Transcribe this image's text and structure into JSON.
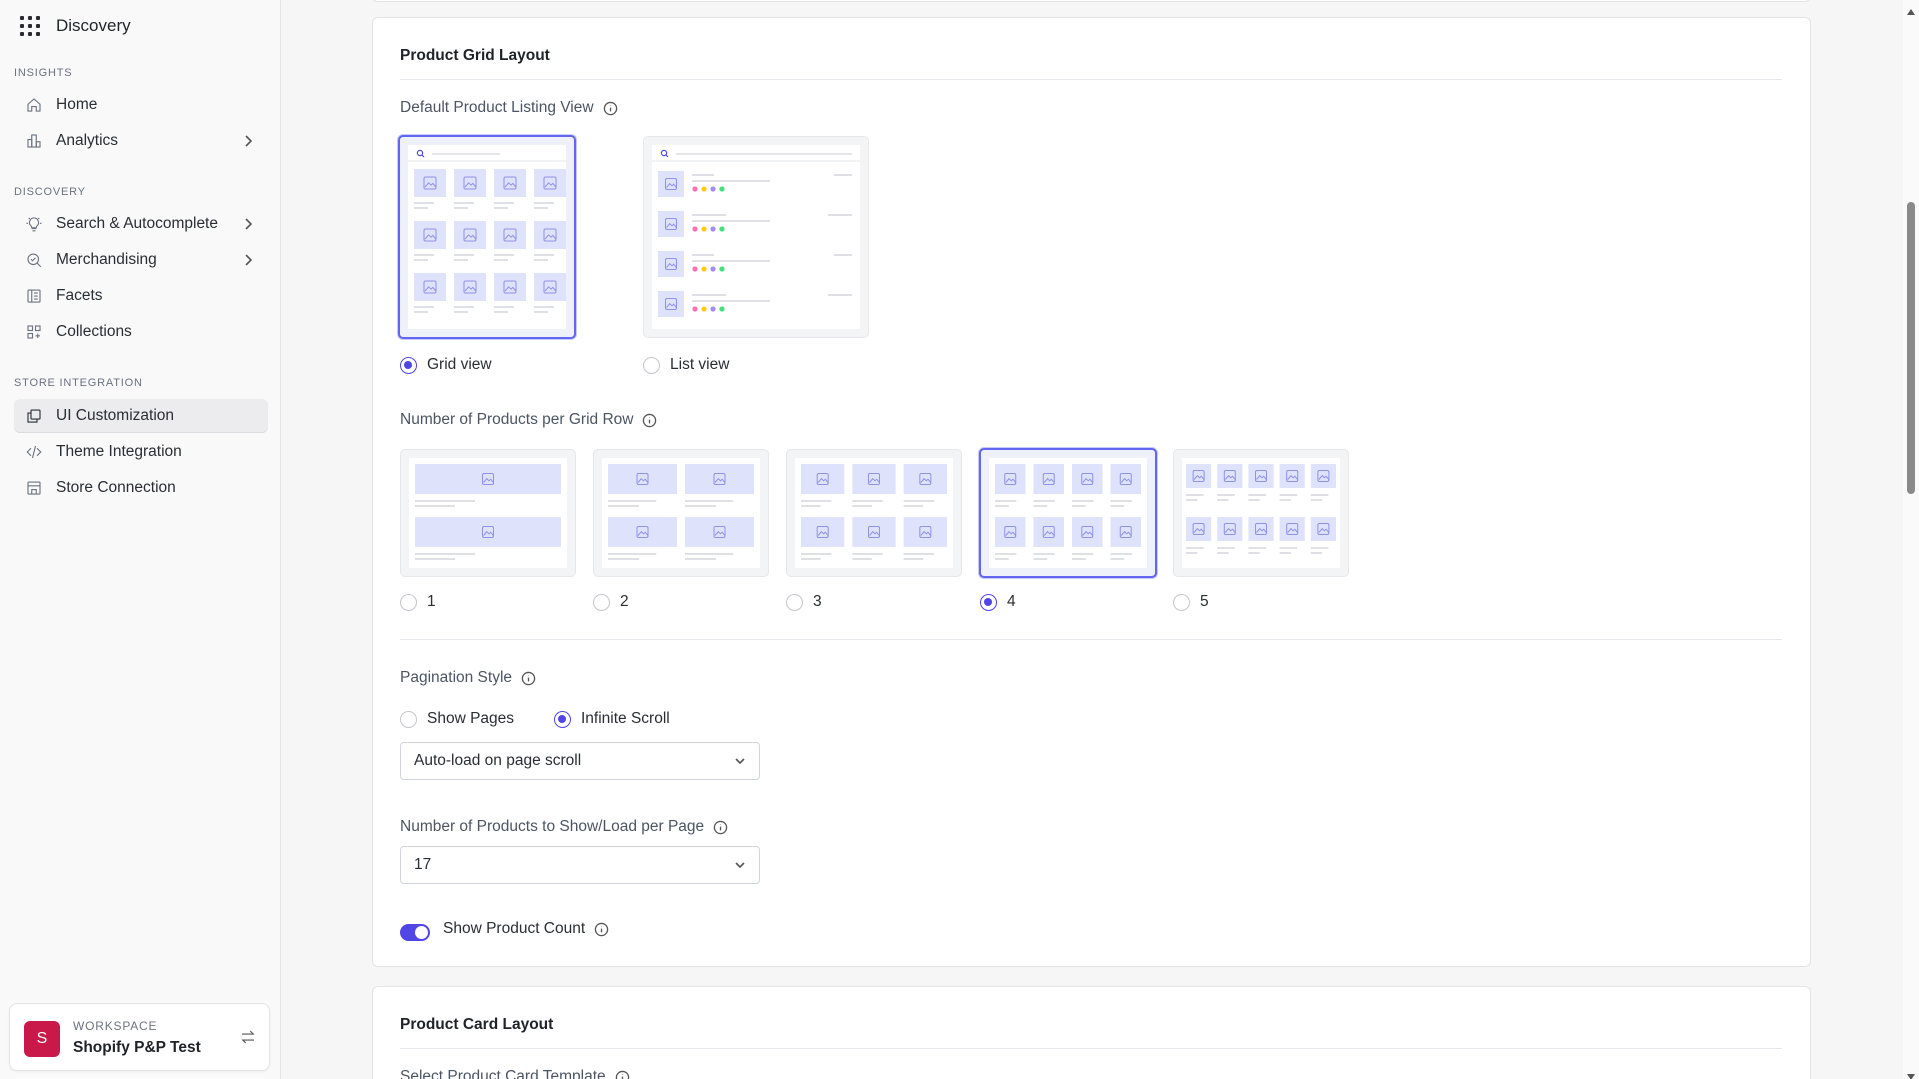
{
  "app": {
    "title": "Discovery"
  },
  "sidebar": {
    "sections": [
      {
        "label": "INSIGHTS"
      },
      {
        "label": "DISCOVERY"
      },
      {
        "label": "STORE INTEGRATION"
      }
    ],
    "items": [
      {
        "label": "Home",
        "icon": "home-icon"
      },
      {
        "label": "Analytics",
        "icon": "analytics-icon"
      },
      {
        "label": "Search & Autocomplete",
        "icon": "bulb-icon"
      },
      {
        "label": "Merchandising",
        "icon": "merchandising-icon"
      },
      {
        "label": "Facets",
        "icon": "facets-icon"
      },
      {
        "label": "Collections",
        "icon": "collections-icon"
      },
      {
        "label": "UI Customization",
        "icon": "copy-icon",
        "active": true
      },
      {
        "label": "Theme Integration",
        "icon": "code-icon"
      },
      {
        "label": "Store Connection",
        "icon": "store-icon"
      }
    ],
    "workspace": {
      "label": "WORKSPACE",
      "name": "Shopify P&P Test",
      "avatar_letter": "S",
      "avatar_color": "#c9184a"
    }
  },
  "grid_layout": {
    "title": "Product Grid Layout",
    "listing_view": {
      "label": "Default Product Listing View",
      "options": [
        "Grid view",
        "List view"
      ],
      "selected": "Grid view"
    },
    "per_row": {
      "label": "Number of Products per Grid Row",
      "options": [
        "1",
        "2",
        "3",
        "4",
        "5"
      ],
      "selected": "4"
    },
    "pagination": {
      "label": "Pagination Style",
      "options": [
        "Show Pages",
        "Infinite Scroll"
      ],
      "selected": "Infinite Scroll",
      "mode_value": "Auto-load on page scroll"
    },
    "per_page": {
      "label": "Number of Products to Show/Load per Page",
      "value": "17"
    },
    "product_count": {
      "label": "Show Product Count",
      "enabled": true
    }
  },
  "card_layout": {
    "title": "Product Card Layout",
    "template_label": "Select Product Card Template"
  },
  "colors": {
    "accent": "#4f46e5",
    "selected_border": "#6366f1",
    "placeholder": "#dfe2fb"
  }
}
